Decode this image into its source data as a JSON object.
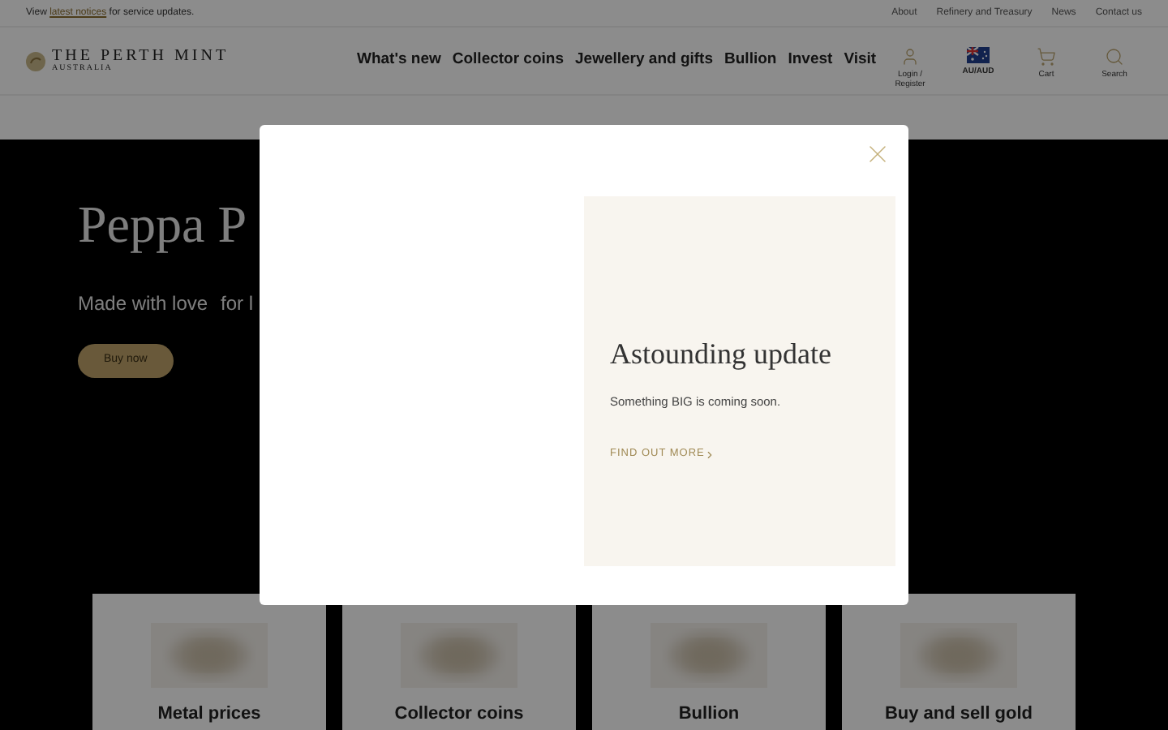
{
  "notice_bar": {
    "prefix": "View",
    "link": "latest notices",
    "suffix": "for service updates.",
    "links": [
      "About",
      "Refinery and Treasury",
      "News",
      "Contact us"
    ]
  },
  "header": {
    "logo_title": "THE PERTH MINT",
    "logo_subtitle": "AUSTRALIA",
    "nav": [
      "What's new",
      "Collector coins",
      "Jewellery and gifts",
      "Bullion",
      "Invest",
      "Visit"
    ],
    "actions": [
      {
        "kind": "user",
        "label": "Login / Register"
      },
      {
        "kind": "flag",
        "label": "AU/AUD"
      },
      {
        "kind": "cart",
        "label": "Cart"
      },
      {
        "kind": "search",
        "label": "Search"
      }
    ]
  },
  "hero": {
    "title": "Peppa P",
    "subtitle_parts": [
      "Made with love",
      "for l"
    ],
    "button": "Buy now"
  },
  "cards": [
    {
      "title": "Metal prices"
    },
    {
      "title": "Collector coins"
    },
    {
      "title": "Bullion"
    },
    {
      "title": "Buy and sell gold"
    }
  ],
  "modal": {
    "title": "Astounding update",
    "text": "Something BIG is coming soon.",
    "link": "FIND OUT MORE"
  }
}
